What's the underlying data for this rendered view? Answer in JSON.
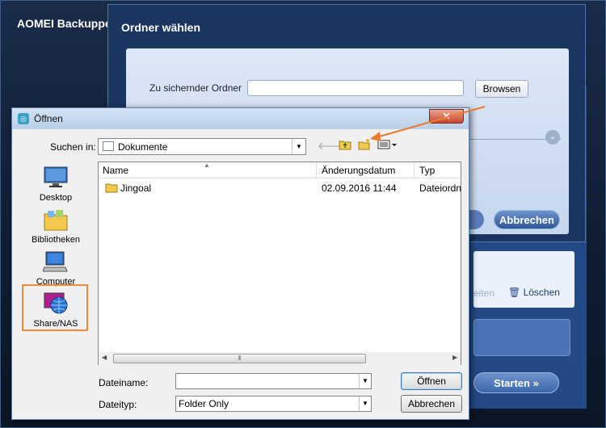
{
  "app": {
    "title": "AOMEI Backupper",
    "close_label": "✕",
    "bg_delete_label": "Löschen",
    "bg_edit_label": "eiten",
    "bg_start_label": "Starten"
  },
  "folder_dialog": {
    "title": "Ordner wählen",
    "source_label": "Zu sichernder Ordner",
    "source_value": "",
    "browse_label": "Browsen",
    "cancel_label": "Abbrechen"
  },
  "open_dialog": {
    "title": "Öffnen",
    "close_label": "✕",
    "look_in_label": "Suchen in:",
    "look_in_value": "Dokumente",
    "places": [
      {
        "label": "Desktop",
        "icon": "desktop-icon"
      },
      {
        "label": "Bibliotheken",
        "icon": "libraries-icon"
      },
      {
        "label": "Computer",
        "icon": "computer-icon"
      },
      {
        "label": "Share/NAS",
        "icon": "network-share-icon"
      }
    ],
    "columns": [
      "Name",
      "Änderungsdatum",
      "Typ"
    ],
    "rows": [
      {
        "name": "Jingoal",
        "date": "02.09.2016 11:44",
        "type": "Dateiordn"
      }
    ],
    "filename_label": "Dateiname:",
    "filename_value": "",
    "filetype_label": "Dateityp:",
    "filetype_value": "Folder Only",
    "open_button": "Öffnen",
    "cancel_button": "Abbrechen"
  },
  "colors": {
    "accent_arrow": "#f0782e",
    "highlight_box": "#f08a3a"
  }
}
